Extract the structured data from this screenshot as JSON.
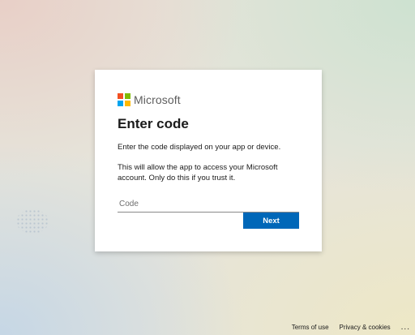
{
  "brand": {
    "name": "Microsoft",
    "logo_colors": [
      "#f25022",
      "#7fba00",
      "#00a4ef",
      "#ffb900"
    ]
  },
  "card": {
    "title": "Enter code",
    "description": "Enter the code displayed on your app or device.",
    "warning": "This will allow the app to access your Microsoft account. Only do this if you trust it.",
    "code_input": {
      "placeholder": "Code",
      "value": ""
    },
    "next_label": "Next"
  },
  "footer": {
    "terms_label": "Terms of use",
    "privacy_label": "Privacy & cookies",
    "more_label": "..."
  },
  "colors": {
    "primary_button": "#0067b8",
    "card_background": "#ffffff"
  }
}
